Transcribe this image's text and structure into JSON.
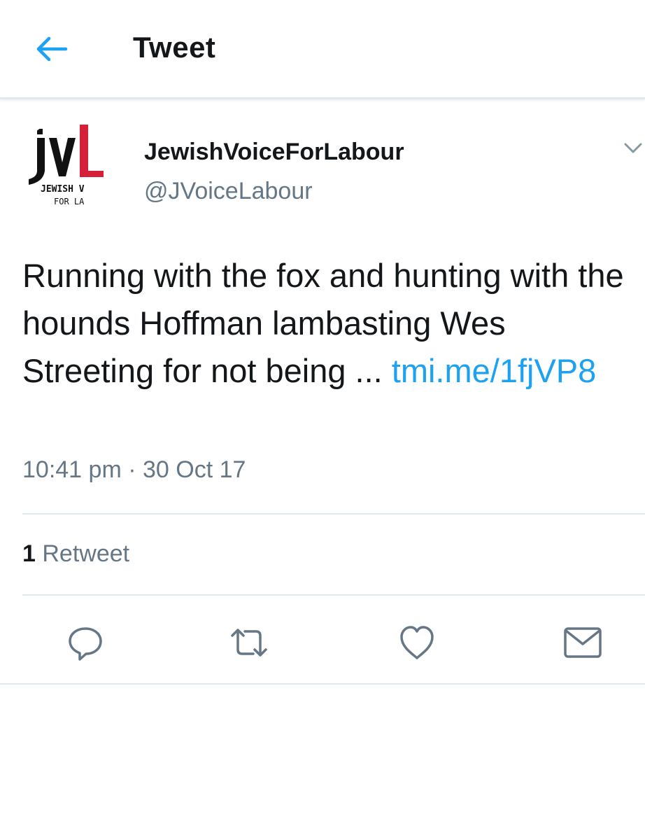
{
  "header": {
    "title": "Tweet"
  },
  "user": {
    "name": "JewishVoiceForLabour",
    "handle": "@JVoiceLabour",
    "avatar": {
      "logo_text": "jvL",
      "line1": "JEWISH V",
      "line2": "FOR LA"
    }
  },
  "tweet": {
    "text": "Running with the fox and hunting with the hounds  Hoffman lambasting Wes Streeting for not being ... ",
    "link": "tmi.me/1fjVP8",
    "time": "10:41 pm",
    "separator": "·",
    "date": "30 Oct 17"
  },
  "stats": {
    "retweet_count": "1",
    "retweet_label": "Retweet"
  },
  "actions": [
    {
      "icon": "reply-icon"
    },
    {
      "icon": "retweet-icon"
    },
    {
      "icon": "like-icon"
    },
    {
      "icon": "direct-message-icon"
    }
  ],
  "colors": {
    "accent": "#1da1f2",
    "secondary_text": "#657786",
    "divider": "#e1e8ed",
    "logo_red": "#d6203a"
  }
}
